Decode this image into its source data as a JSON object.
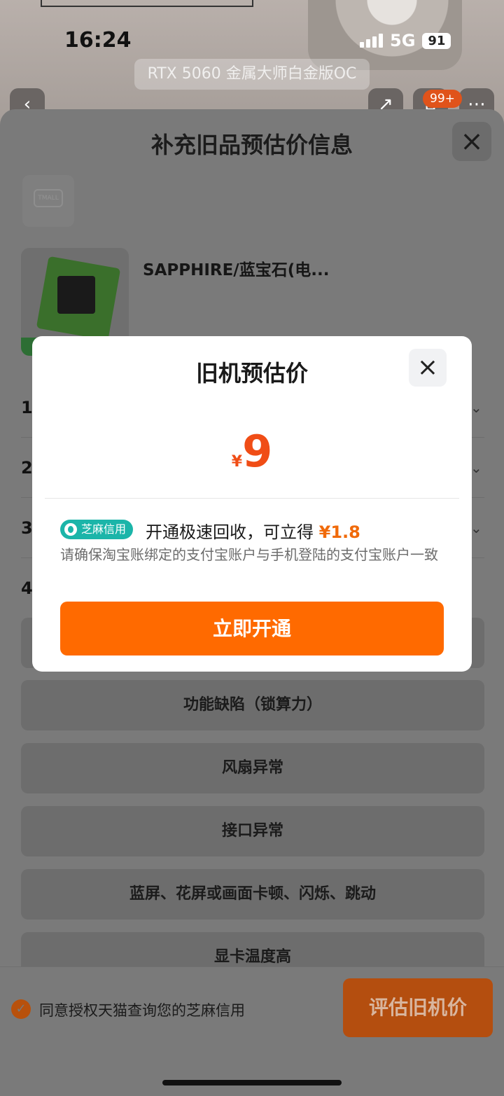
{
  "status_bar": {
    "time": "16:24",
    "network": "5G",
    "battery": "91"
  },
  "background": {
    "product_pill": "RTX 5060 金属大师白金版OC",
    "cart_badge": "99+"
  },
  "sheet": {
    "title": "补充旧品预估价信息",
    "tmall_logo": "TMALL",
    "product_name": "SAPPHIRE/蓝宝石(电...",
    "questions": [
      "1",
      "2",
      "3",
      "4"
    ],
    "options": [
      "功能缺陷（锁算力）",
      "风扇异常",
      "接口异常",
      "蓝屏、花屏或画面卡顿、闪烁、跳动",
      "显卡温度高"
    ]
  },
  "bottom_bar": {
    "agree_text": "同意授权天猫查询您的芝麻信用",
    "eval_button": "评估旧机价"
  },
  "modal": {
    "title": "旧机预估价",
    "currency": "¥",
    "price": "9",
    "zhima_badge": "芝麻信用",
    "offer_text": "开通极速回收，可立得",
    "offer_amount": "¥1.8",
    "note": "请确保淘宝账绑定的支付宝账户与手机登陆的支付宝账户一致",
    "cta": "立即开通"
  },
  "colors": {
    "accent": "#ff6a00",
    "price": "#f04d16",
    "zhima": "#1bb5a9"
  }
}
